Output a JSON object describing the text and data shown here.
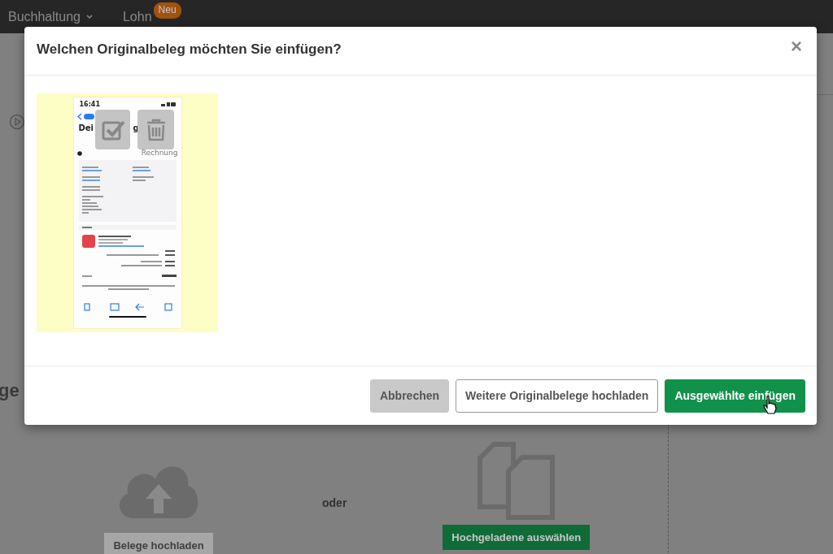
{
  "nav": {
    "items": [
      {
        "label": "Buchhaltung",
        "dropdown": true
      },
      {
        "label": "Lohn",
        "dropdown": false,
        "badge": "Neu"
      }
    ]
  },
  "background": {
    "heading_fragment": "ge",
    "upload_button": "Belege hochladen",
    "separator": "oder",
    "select_button": "Hochgeladene auswählen"
  },
  "dialog": {
    "title": "Welchen Originalbeleg möchten Sie einfügen?",
    "close": "×",
    "documents": [
      {
        "time": "16:41",
        "heading_start": "Dei",
        "heading_end": "g",
        "doc_label": "Rechnung"
      }
    ],
    "buttons": [
      {
        "label": "Abbrechen",
        "kind": "secondary"
      },
      {
        "label": "Weitere Originalbelege hochladen",
        "kind": "outline"
      },
      {
        "label": "Ausgewählte einfügen",
        "kind": "primary"
      }
    ]
  }
}
